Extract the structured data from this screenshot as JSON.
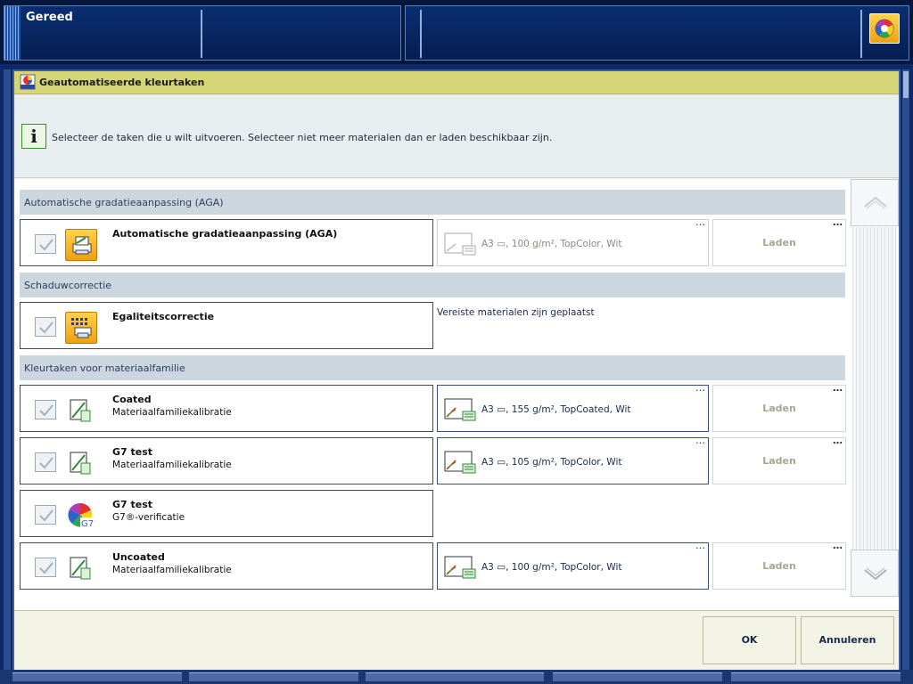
{
  "statusbar": {
    "status": "Gereed",
    "status_icon": "color-status-icon"
  },
  "dialog": {
    "title": "Geautomatiseerde kleurtaken",
    "title_icon": "auto-color-icon",
    "info_icon": "info-icon",
    "info_text": "Selecteer de taken die u wilt uitvoeren. Selecteer niet meer materialen dan er laden beschikbaar zijn."
  },
  "sections": [
    {
      "label": "Automatische gradatieaanpassing (AGA)"
    },
    {
      "label": "Schaduwcorrectie"
    },
    {
      "label": "Kleurtaken voor materiaalfamilie"
    }
  ],
  "tasks": [
    {
      "name": "Automatische gradatieaanpassing (AGA)",
      "sub": "",
      "icon": "printer-gradation-icon",
      "checked": true,
      "media": "A3 ▭, 100 g/m², TopColor, Wit",
      "media_enabled": false,
      "load": "Laden"
    },
    {
      "name": "Egaliteitscorrectie",
      "sub": "",
      "icon": "uniformity-correction-icon",
      "checked": true,
      "required_note": "Vereiste materialen zijn geplaatst"
    },
    {
      "name": "Coated",
      "sub": "Materiaalfamiliekalibratie",
      "icon": "media-calibration-icon",
      "checked": true,
      "media": "A3 ▭, 155 g/m², TopCoated, Wit",
      "media_enabled": true,
      "load": "Laden"
    },
    {
      "name": "G7 test",
      "sub": "Materiaalfamiliekalibratie",
      "icon": "media-calibration-icon",
      "checked": true,
      "media": "A3 ▭, 105 g/m², TopColor, Wit",
      "media_enabled": true,
      "load": "Laden"
    },
    {
      "name": "G7 test",
      "sub": "G7®-verificatie",
      "icon": "g7-verification-icon",
      "checked": true
    },
    {
      "name": "Uncoated",
      "sub": "Materiaalfamiliekalibratie",
      "icon": "media-calibration-icon",
      "checked": true,
      "media": "A3 ▭, 100 g/m², TopColor, Wit",
      "media_enabled": true,
      "load": "Laden"
    }
  ],
  "more_dots": "…",
  "buttons": {
    "ok": "OK",
    "cancel": "Annuleren"
  },
  "colors": {
    "titlebar": "#d6d678",
    "accent": "#f0a010",
    "section_bg": "#ccd6de",
    "frame": "#0d2a66"
  }
}
